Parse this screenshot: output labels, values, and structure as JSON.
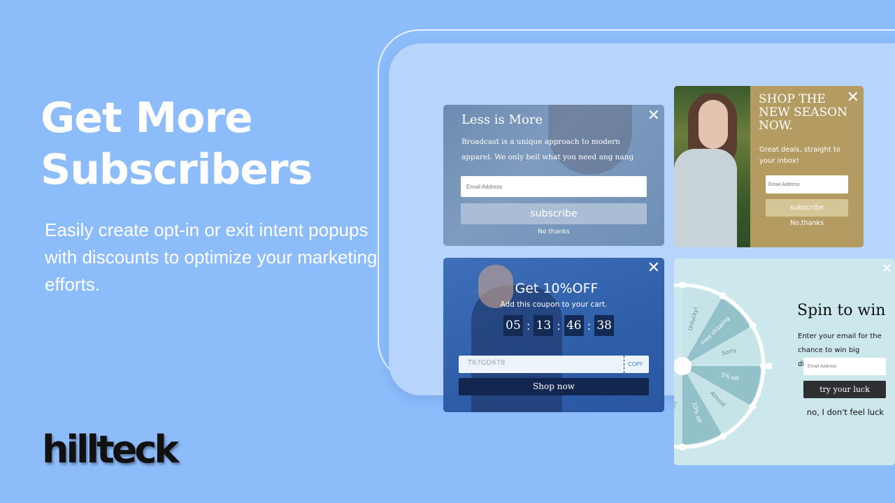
{
  "hero": {
    "headline_line1": "Get More",
    "headline_line2": "Subscribers",
    "subtitle": "Easily create opt-in or exit intent popups with discounts to optimize your marketing efforts."
  },
  "logo": {
    "text": "hillteck"
  },
  "colors": {
    "background": "#8dbcfb",
    "panel": "#b7d4fc",
    "gold": "#b39b62",
    "navy": "#13264f",
    "spin_bg": "#cde8ec"
  },
  "popup_less": {
    "title": "Less is More",
    "body": "Broadcast is a unique approach to modern apparel. We only bell what you need ang nang",
    "email_placeholder": "Email Address",
    "button": "subscribe",
    "decline": "No thanks",
    "close_icon": "close-icon"
  },
  "popup_season": {
    "title": "SHOP THE NEW SEASON NOW.",
    "body": "Great deals, straight to your inbox!",
    "email_placeholder": "Email Address",
    "button": "subscribe",
    "decline": "No,thanks"
  },
  "popup_coupon": {
    "title": "Get 10%OFF",
    "body": "Add this coupon to your cart.",
    "countdown": [
      "05",
      "13",
      "46",
      "38"
    ],
    "code": "T67GD678",
    "copy": "COPY",
    "button": "Shop now"
  },
  "popup_spin": {
    "title": "Spin to win",
    "body": "Enter your email for the chance to win big discounts.",
    "email_placeholder": "Email Address",
    "button": "try your luck",
    "decline": "no, I don't feel luck",
    "wheel_segments": [
      "Unlucky!",
      "Free shipping",
      "Sorry",
      "5% off",
      "Almost",
      "10% off",
      "Unlucky!"
    ]
  }
}
